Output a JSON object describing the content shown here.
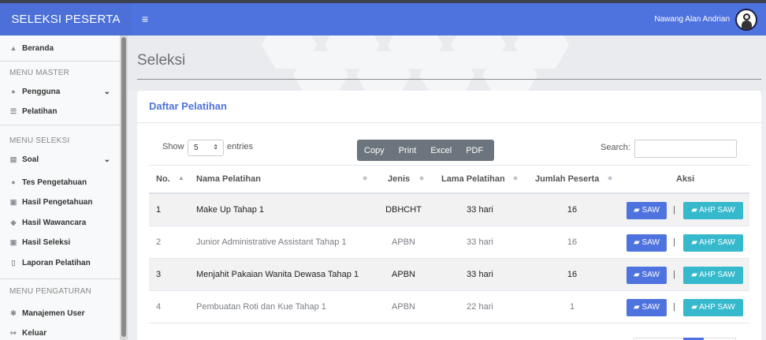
{
  "navbar": {
    "brand": "SELEKSI PESERTA",
    "toggle_icon": "≡",
    "user_name": "Nawang Alan Andrian"
  },
  "sidebar": {
    "beranda": "Beranda",
    "header_master": "MENU MASTER",
    "pengguna": "Pengguna",
    "pelatihan": "Pelatihan",
    "header_seleksi": "MENU SELEKSI",
    "soal": "Soal",
    "tes_pengetahuan": "Tes Pengetahuan",
    "hasil_pengetahuan": "Hasil Pengetahuan",
    "hasil_wawancara": "Hasil Wawancara",
    "hasil_seleksi": "Hasil Seleksi",
    "laporan_pelatihan": "Laporan Pelatihan",
    "header_pengaturan": "MENU PENGATURAN",
    "manajemen_user": "Manajemen User",
    "keluar": "Keluar"
  },
  "page": {
    "title": "Seleksi"
  },
  "card": {
    "title": "Daftar Pelatihan"
  },
  "controls": {
    "show_label": "Show",
    "show_value": "5",
    "entries_label": "entries",
    "buttons": [
      "Copy",
      "Print",
      "Excel",
      "PDF"
    ],
    "search_label": "Search:",
    "search_value": ""
  },
  "table": {
    "headers": [
      "No.",
      "Nama Pelatihan",
      "Jenis",
      "Lama Pelatihan",
      "Jumlah Peserta",
      "Aksi"
    ],
    "rows": [
      {
        "no": "1",
        "nama": "Make Up Tahap 1",
        "jenis": "DBHCHT",
        "lama": "33 hari",
        "jumlah": "16"
      },
      {
        "no": "2",
        "nama": "Junior Administrative Assistant Tahap 1",
        "jenis": "APBN",
        "lama": "33 hari",
        "jumlah": "16"
      },
      {
        "no": "3",
        "nama": "Menjahit Pakaian Wanita Dewasa Tahap 1",
        "jenis": "APBN",
        "lama": "33 hari",
        "jumlah": "16"
      },
      {
        "no": "4",
        "nama": "Pembuatan Roti dan Kue Tahap 1",
        "jenis": "APBN",
        "lama": "22 hari",
        "jumlah": "1"
      }
    ],
    "saw_label": "SAW",
    "ahp_label": "AHP SAW",
    "separator": "|"
  },
  "colors": {
    "primary": "#4e73df",
    "info": "#36b9cc",
    "secondary": "#6c757d"
  },
  "icons": {
    "home": "home-icon",
    "user": "user-icon",
    "list": "list-icon",
    "clipboard": "clipboard-icon",
    "users": "users-icon",
    "id-card": "id-card-icon",
    "comments": "comments-icon",
    "check-square": "check-square-icon",
    "file": "file-icon",
    "users-cog": "users-cog-icon",
    "sign-out": "sign-out-icon",
    "folder-open": "folder-open-icon",
    "chevron": "chevron-down-icon"
  }
}
